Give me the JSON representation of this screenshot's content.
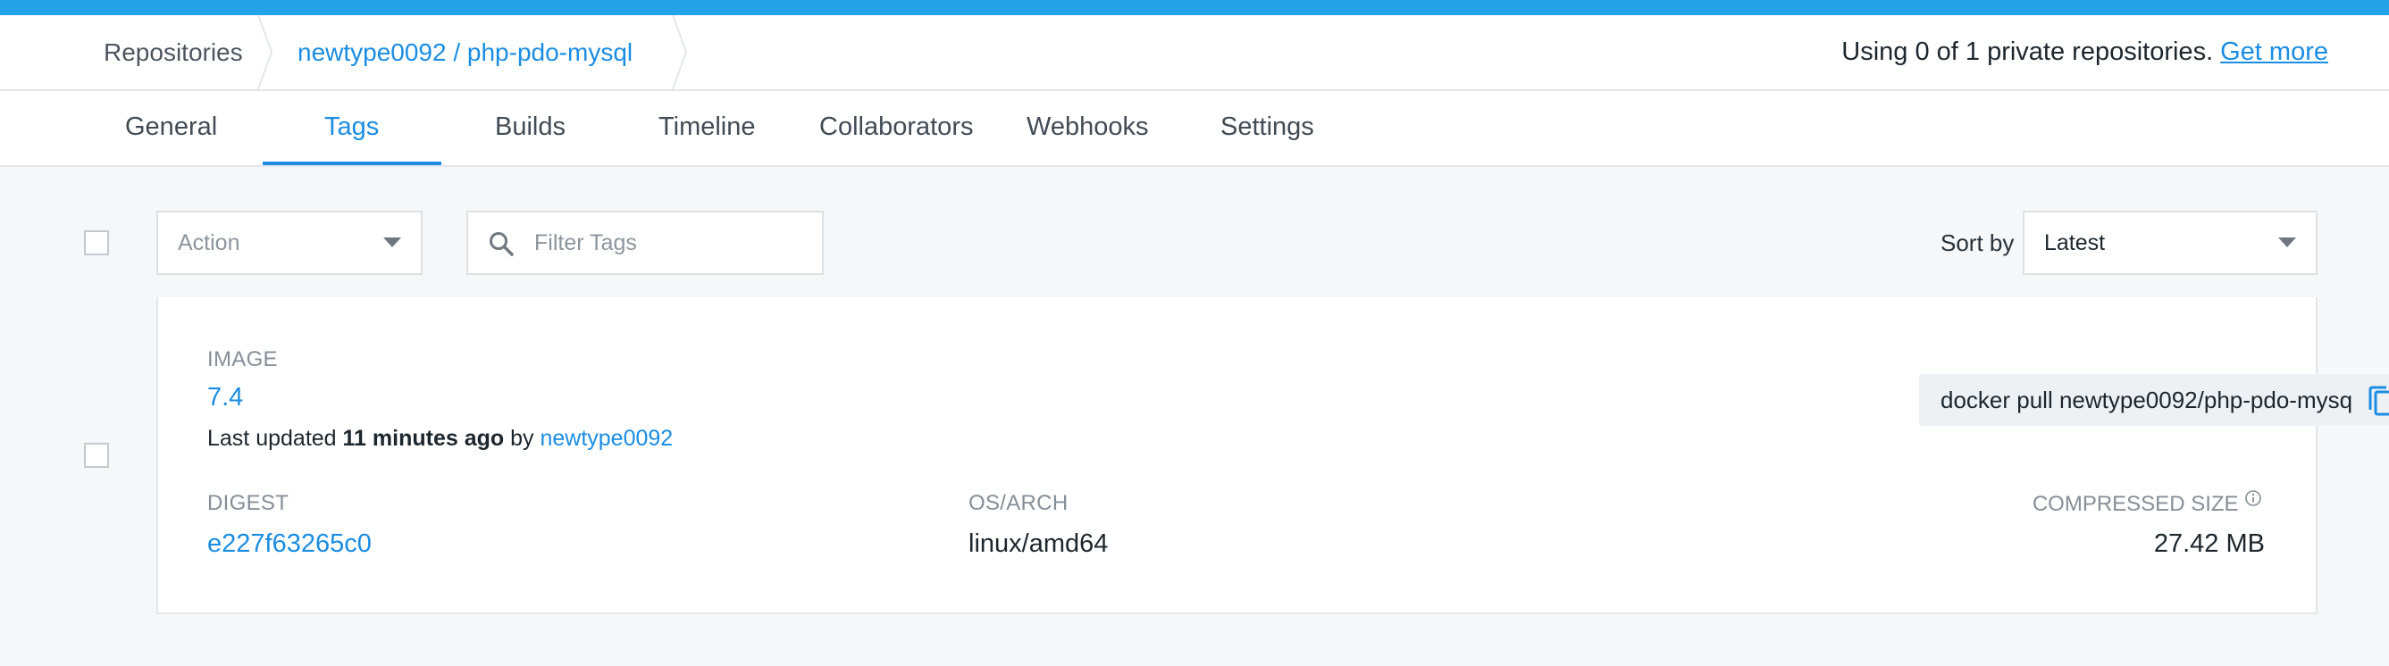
{
  "breadcrumb": {
    "root": "Repositories",
    "repo": "newtype0092 / php-pdo-mysql"
  },
  "usage": {
    "text": "Using 0 of 1 private repositories.",
    "link": "Get more"
  },
  "tabs": [
    {
      "label": "General"
    },
    {
      "label": "Tags",
      "active": true
    },
    {
      "label": "Builds"
    },
    {
      "label": "Timeline"
    },
    {
      "label": "Collaborators"
    },
    {
      "label": "Webhooks"
    },
    {
      "label": "Settings"
    }
  ],
  "toolbar": {
    "action_placeholder": "Action",
    "filter_placeholder": "Filter Tags",
    "sort_label": "Sort by",
    "sort_value": "Latest"
  },
  "tag": {
    "image_label": "IMAGE",
    "image_name": "7.4",
    "updated_prefix": "Last updated",
    "updated_time": "11 minutes ago",
    "updated_by_word": "by",
    "updated_user": "newtype0092",
    "pull_command": "docker pull newtype0092/php-pdo-mysq",
    "digest_label": "DIGEST",
    "digest": "e227f63265c0",
    "osarch_label": "OS/ARCH",
    "osarch": "linux/amd64",
    "size_label": "COMPRESSED SIZE",
    "size": "27.42 MB"
  },
  "colors": {
    "accent": "#1a8de3",
    "topbar": "#23a2e8",
    "background": "#f5f7f9"
  }
}
